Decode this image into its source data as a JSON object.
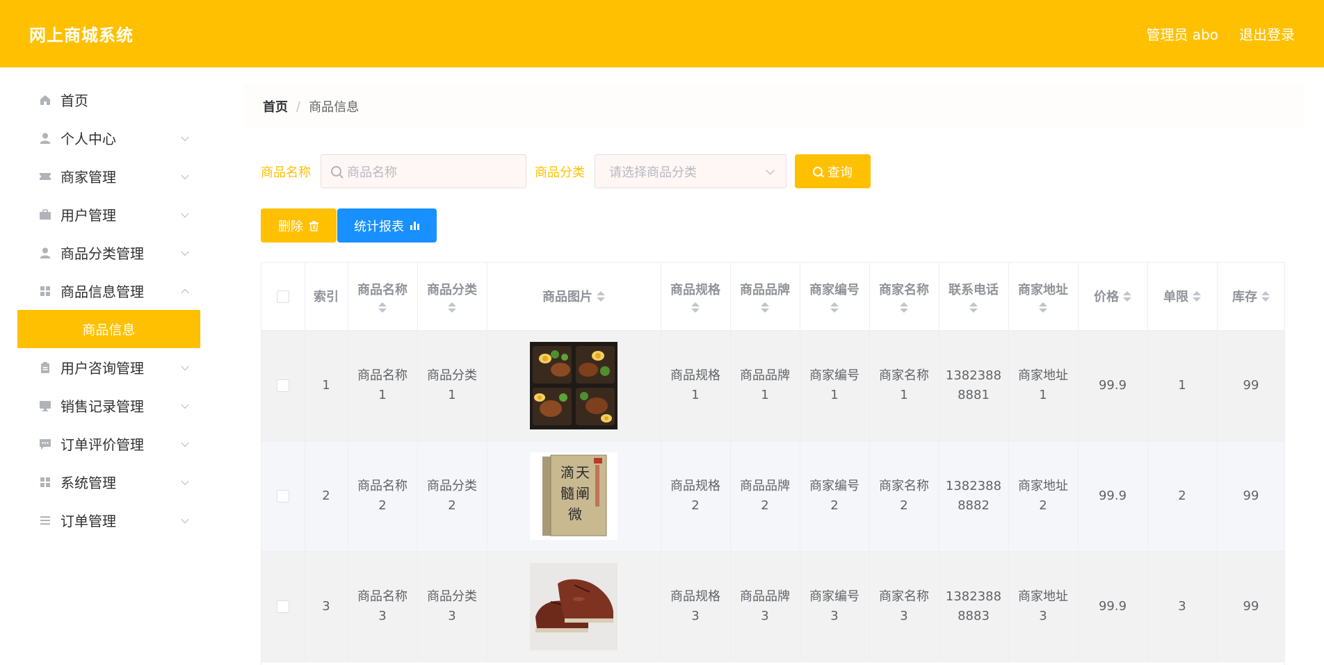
{
  "header": {
    "title": "网上商城系统",
    "admin": "管理员 abo",
    "logout": "退出登录",
    "accent": "#ffc001"
  },
  "sidebar": {
    "items": [
      {
        "label": "首页",
        "icon": "home-icon",
        "has_children": false
      },
      {
        "label": "个人中心",
        "icon": "user-icon",
        "has_children": true
      },
      {
        "label": "商家管理",
        "icon": "ticket-icon",
        "has_children": true
      },
      {
        "label": "用户管理",
        "icon": "briefcase-icon",
        "has_children": true
      },
      {
        "label": "商品分类管理",
        "icon": "user-icon",
        "has_children": true
      },
      {
        "label": "商品信息管理",
        "icon": "grid-icon",
        "has_children": true
      },
      {
        "label": "用户咨询管理",
        "icon": "clipboard-icon",
        "has_children": true
      },
      {
        "label": "销售记录管理",
        "icon": "monitor-icon",
        "has_children": true
      },
      {
        "label": "订单评价管理",
        "icon": "chat-icon",
        "has_children": true
      },
      {
        "label": "系统管理",
        "icon": "grid-icon",
        "has_children": true
      },
      {
        "label": "订单管理",
        "icon": "list-icon",
        "has_children": true
      }
    ],
    "active_sub": "商品信息"
  },
  "breadcrumb": {
    "home": "首页",
    "sep": "/",
    "current": "商品信息"
  },
  "search": {
    "name_label": "商品名称",
    "name_placeholder": "商品名称",
    "category_label": "商品分类",
    "category_placeholder": "请选择商品分类",
    "query_button": "查询"
  },
  "actions": {
    "delete": "删除",
    "stats": "统计报表"
  },
  "table": {
    "headers": {
      "index": "索引",
      "name": "商品名称",
      "category": "商品分类",
      "image": "商品图片",
      "spec": "商品规格",
      "brand": "商品品牌",
      "merchant_no": "商家编号",
      "merchant_name": "商家名称",
      "phone": "联系电话",
      "address": "商家地址",
      "price": "价格",
      "limit": "单限",
      "stock": "库存"
    },
    "rows": [
      {
        "index": "1",
        "name": "商品名称1",
        "category": "商品分类1",
        "image": "food-image",
        "spec": "商品规格1",
        "brand": "商品品牌1",
        "merchant_no": "商家编号1",
        "merchant_name": "商家名称1",
        "phone": "13823888881",
        "address": "商家地址1",
        "price": "99.9",
        "limit": "1",
        "stock": "99"
      },
      {
        "index": "2",
        "name": "商品名称2",
        "category": "商品分类2",
        "image": "book-image",
        "spec": "商品规格2",
        "brand": "商品品牌2",
        "merchant_no": "商家编号2",
        "merchant_name": "商家名称2",
        "phone": "13823888882",
        "address": "商家地址2",
        "price": "99.9",
        "limit": "2",
        "stock": "99"
      },
      {
        "index": "3",
        "name": "商品名称3",
        "category": "商品分类3",
        "image": "shoes-image",
        "spec": "商品规格3",
        "brand": "商品品牌3",
        "merchant_no": "商家编号3",
        "merchant_name": "商家名称3",
        "phone": "13823888883",
        "address": "商家地址3",
        "price": "99.9",
        "limit": "3",
        "stock": "99"
      }
    ]
  }
}
